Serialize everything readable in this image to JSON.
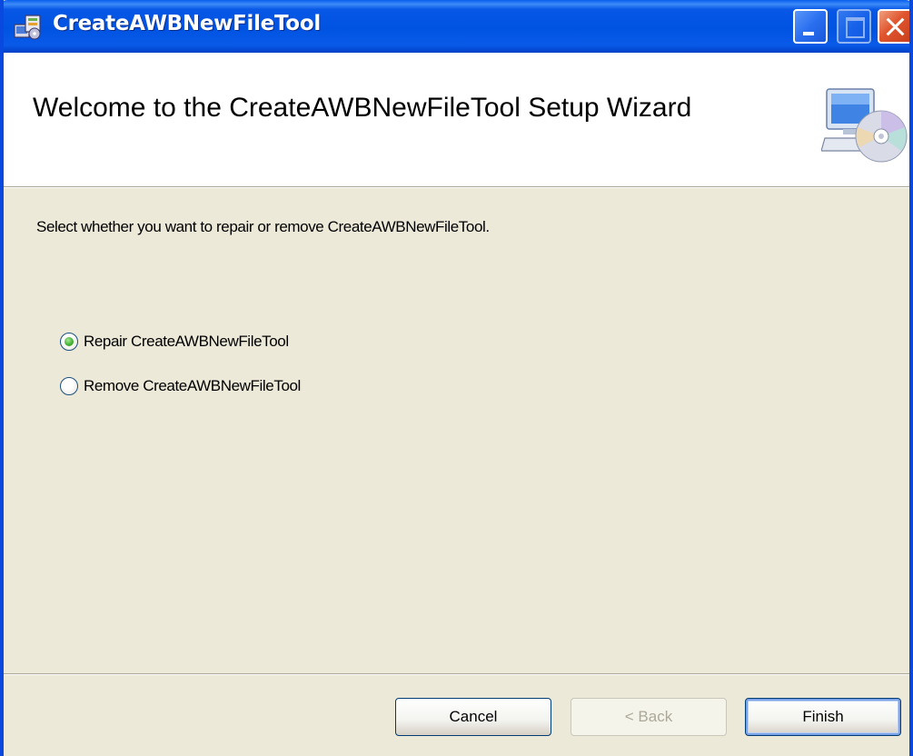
{
  "window": {
    "title": "CreateAWBNewFileTool",
    "controls": {
      "minimize": "minimize-icon",
      "maximize": "maximize-icon",
      "close": "close-icon"
    }
  },
  "banner": {
    "title": "Welcome to the CreateAWBNewFileTool Setup Wizard",
    "icon": "computer-cd-icon"
  },
  "instruction": "Select whether you want to repair or remove CreateAWBNewFileTool.",
  "options": [
    {
      "label": "Repair CreateAWBNewFileTool",
      "selected": true
    },
    {
      "label": "Remove CreateAWBNewFileTool",
      "selected": false
    }
  ],
  "buttons": {
    "cancel": "Cancel",
    "back": "< Back",
    "finish": "Finish"
  },
  "colors": {
    "titlebar": "#0053e1",
    "dialog_bg": "#ece9d8",
    "banner_bg": "#ffffff",
    "close_button": "#e0552e",
    "radio_selected": "#4cb83a"
  }
}
